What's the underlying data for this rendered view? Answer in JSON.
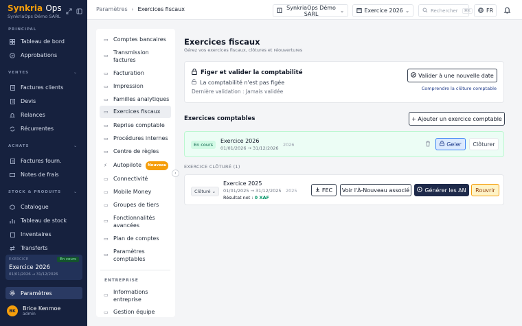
{
  "brand": {
    "name_a": "Synkria",
    "name_b": "Ops",
    "company": "SynkriaOps Démo SARL"
  },
  "sidebar": {
    "sections": {
      "principal": "PRINCIPAL",
      "ventes": "VENTES",
      "achats": "ACHATS",
      "stock": "STOCK & PRODUITS"
    },
    "items": {
      "tableau": "Tableau de bord",
      "approbations": "Approbations",
      "factures_clients": "Factures clients",
      "devis": "Devis",
      "relances": "Relances",
      "recurrentes": "Récurrentes",
      "factures_fourn": "Factures fourn.",
      "notes_frais": "Notes de frais",
      "catalogue": "Catalogue",
      "tableau_stock": "Tableau de stock",
      "inventaires": "Inventaires",
      "transferts": "Transferts",
      "parametres": "Paramètres"
    },
    "exercise": {
      "label": "EXERCICE",
      "name": "Exercice 2026",
      "dates": "01/01/2026 → 31/12/2026",
      "badge": "En cours"
    },
    "user": {
      "initials": "BK",
      "name": "Brice Kenmoe",
      "role": "admin"
    }
  },
  "topbar": {
    "crumb_root": "Paramètres",
    "crumb_current": "Exercices fiscaux",
    "company": "SynkriaOps Démo SARL",
    "exercise": "Exercice 2026",
    "search_placeholder": "Rechercher",
    "search_shortcut": "⌘K",
    "lang": "FR"
  },
  "settings_nav": {
    "items": [
      "Comptes bancaires",
      "Transmission factures",
      "Facturation",
      "Impression",
      "Familles analytiques",
      "Exercices fiscaux",
      "Reprise comptable",
      "Procédures internes",
      "Centre de règles",
      "Autopilote",
      "Connectivité",
      "Mobile Money",
      "Groupes de tiers",
      "Fonctionnalités avancées",
      "Plan de comptes",
      "Paramètres comptables"
    ],
    "new_badge": "Nouveau",
    "section_entreprise": "ENTREPRISE",
    "entreprise_items": [
      "Informations entreprise",
      "Gestion équipe"
    ]
  },
  "page": {
    "title": "Exercices fiscaux",
    "subtitle": "Gérez vos exercices fiscaux, clôtures et réouvertures"
  },
  "freeze": {
    "title": "Figer et valider la comptabilité",
    "status": "La comptabilité n'est pas figée",
    "last": "Dernière validation : Jamais validée",
    "btn": "Valider à une nouvelle date",
    "link": "Comprendre la clôture comptable"
  },
  "exercises": {
    "heading": "Exercices comptables",
    "add_btn": "+ Ajouter un exercice comptable",
    "current": {
      "badge": "En cours",
      "name": "Exercice 2026",
      "dates": "01/01/2026 → 31/12/2026",
      "year": "2026",
      "freeze": "Geler",
      "close": "Clôturer"
    },
    "closed_heading": "EXERCICE CLÔTURÉ (1)",
    "closed": {
      "badge": "Clôturé",
      "name": "Exercice 2025",
      "dates": "01/01/2025 → 31/12/2025",
      "year": "2025",
      "result_label": "Résultat net : ",
      "result_value": "0 XAF",
      "fec": "FEC",
      "an_view": "Voir l'À-Nouveau associé",
      "an_gen": "Générer les AN",
      "reopen": "Rouvrir"
    }
  },
  "colors": {
    "sidebar_bg": "#16213e",
    "accent": "#f59e0b",
    "success_bg": "#ecfdf5",
    "dark_btn": "#1e2a4a"
  }
}
